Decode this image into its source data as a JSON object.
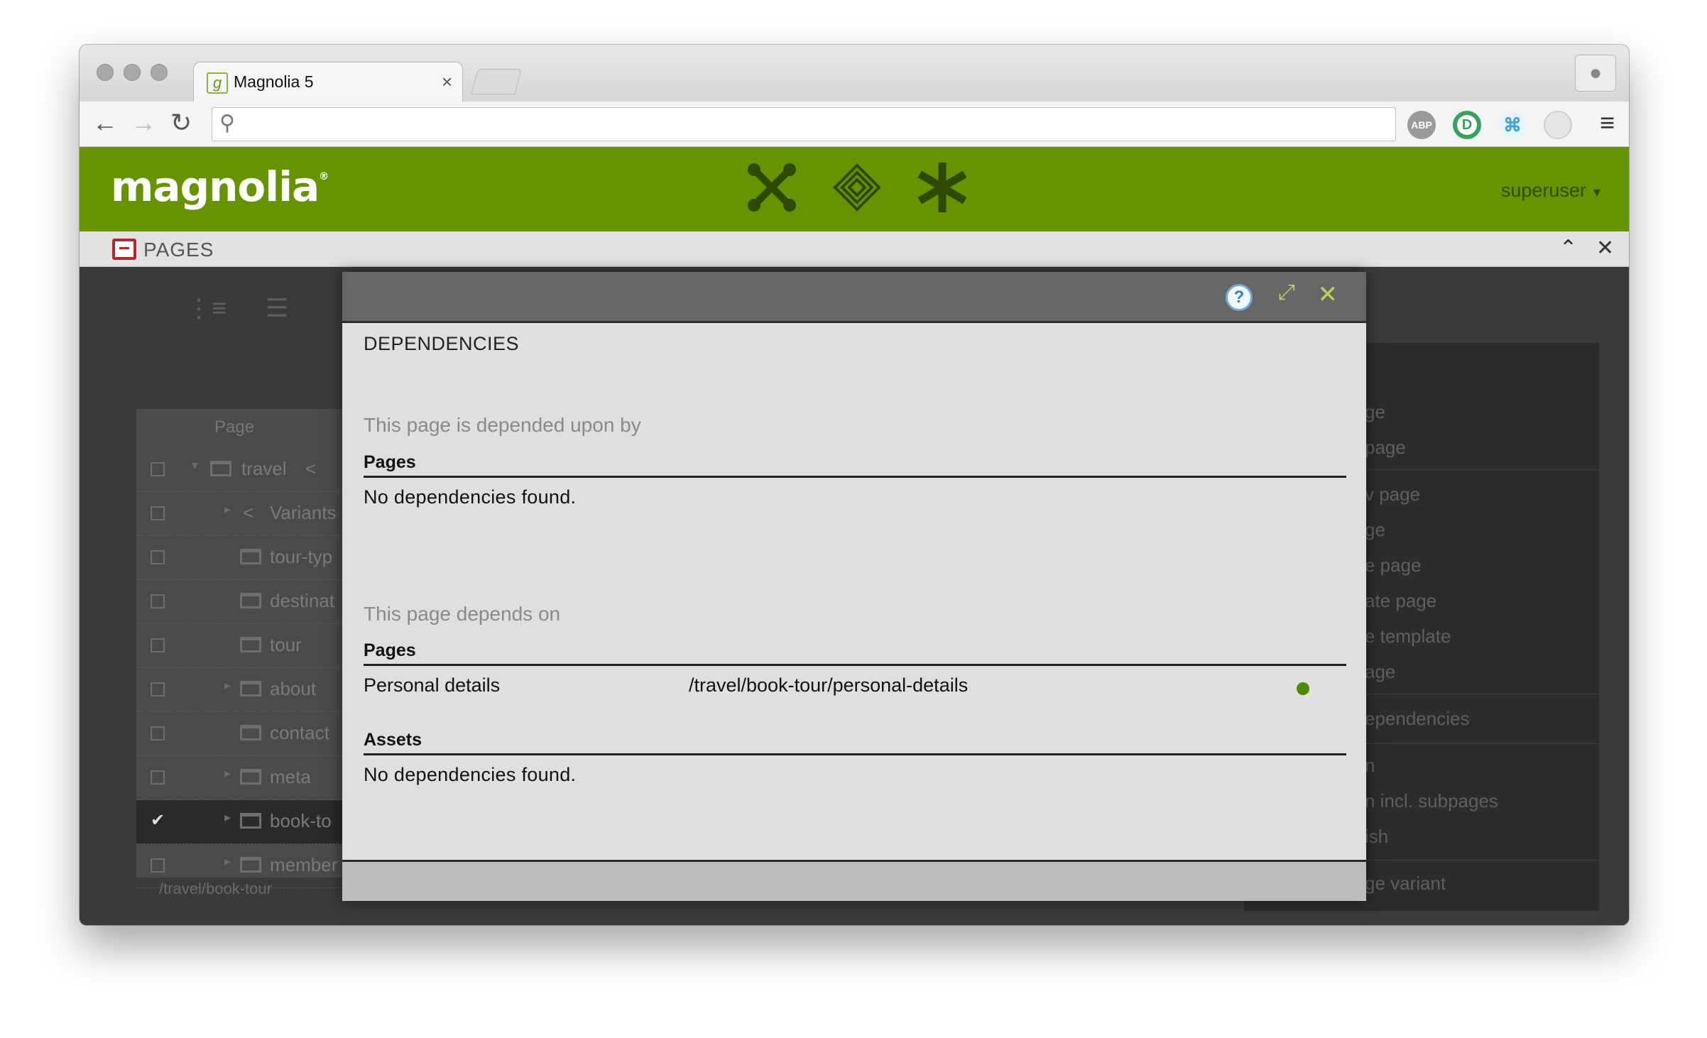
{
  "browser": {
    "tab_title": "Magnolia 5",
    "tab_favicon": "g",
    "tab_close": "×",
    "url_value": "",
    "nav": {
      "back": "←",
      "forward": "→",
      "reload": "↻"
    },
    "extensions": [
      "ABP",
      "",
      "⌘",
      ""
    ],
    "menu": "≡"
  },
  "app": {
    "logo": "magnolia",
    "logo_mark": "®",
    "brand_color": "#669400",
    "user": "superuser",
    "user_caret": "▾",
    "header_icons": [
      "apps-icon",
      "pulse-icon",
      "favorites-icon"
    ]
  },
  "subapp": {
    "title": "PAGES",
    "collapse": "⌃",
    "close": "✕"
  },
  "tree": {
    "column": "Page",
    "rows": [
      {
        "label": "travel",
        "arrow": "▾",
        "checked": false
      },
      {
        "label": "Variants",
        "arrow": "▸",
        "checked": false
      },
      {
        "label": "tour-typ",
        "arrow": "",
        "checked": false
      },
      {
        "label": "destinat",
        "arrow": "",
        "checked": false
      },
      {
        "label": "tour",
        "arrow": "",
        "checked": false
      },
      {
        "label": "about",
        "arrow": "▸",
        "checked": false
      },
      {
        "label": "contact",
        "arrow": "",
        "checked": false
      },
      {
        "label": "meta",
        "arrow": "▸",
        "checked": false
      },
      {
        "label": "book-to",
        "arrow": "▸",
        "checked": true
      },
      {
        "label": "member",
        "arrow": "▸",
        "checked": false
      }
    ],
    "path": "/travel/book-tour"
  },
  "actions": {
    "items": [
      "ge",
      "page",
      "v page",
      "ge",
      "e page",
      "ate page",
      "e template",
      "age",
      "ependencies",
      "n",
      "n incl. subpages",
      "ish",
      "ge variant"
    ]
  },
  "dialog": {
    "title": "DEPENDENCIES",
    "help": "?",
    "maximize": "⤢",
    "close": "✕",
    "section_depended_upon": "This page is depended upon by",
    "section_depends_on": "This page depends on",
    "group_pages": "Pages",
    "group_assets": "Assets",
    "no_deps": "No dependencies found.",
    "dependency": {
      "name": "Personal details",
      "path": "/travel/book-tour/personal-details",
      "status_color": "#4d8a00"
    }
  }
}
